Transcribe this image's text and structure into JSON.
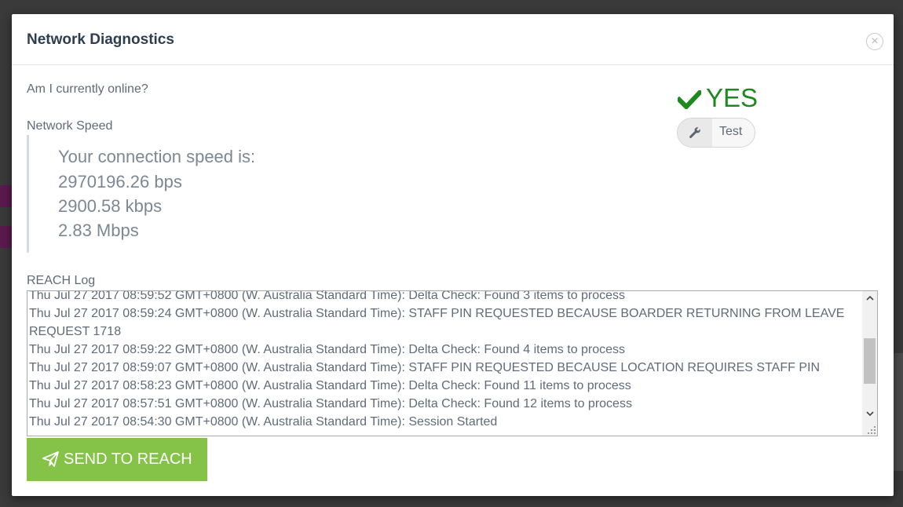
{
  "dialog": {
    "title": "Network Diagnostics",
    "close_icon": "×"
  },
  "online": {
    "question": "Am I currently online?",
    "status": "YES",
    "status_color": "#1e8a1e",
    "test_label": "Test"
  },
  "speed": {
    "label": "Network Speed",
    "heading": "Your connection speed is:",
    "bps": "2970196.26 bps",
    "kbps": "2900.58 kbps",
    "mbps": "2.83 Mbps"
  },
  "log": {
    "label": "REACH Log",
    "lines": [
      "Thu Jul 27 2017 08:59:52 GMT+0800 (W. Australia Standard Time): Delta Check: Found 3 items to process",
      "Thu Jul 27 2017 08:59:24 GMT+0800 (W. Australia Standard Time): STAFF PIN REQUESTED BECAUSE BOARDER RETURNING FROM LEAVE REQUEST 1718",
      "Thu Jul 27 2017 08:59:22 GMT+0800 (W. Australia Standard Time): Delta Check: Found 4 items to process",
      "Thu Jul 27 2017 08:59:07 GMT+0800 (W. Australia Standard Time): STAFF PIN REQUESTED BECAUSE LOCATION REQUIRES STAFF PIN",
      "Thu Jul 27 2017 08:58:23 GMT+0800 (W. Australia Standard Time): Delta Check: Found 11 items to process",
      "Thu Jul 27 2017 08:57:51 GMT+0800 (W. Australia Standard Time): Delta Check: Found 12 items to process",
      "Thu Jul 27 2017 08:54:30 GMT+0800 (W. Australia Standard Time): Session Started"
    ]
  },
  "actions": {
    "send_label": "SEND TO REACH",
    "send_color": "#84c347"
  }
}
